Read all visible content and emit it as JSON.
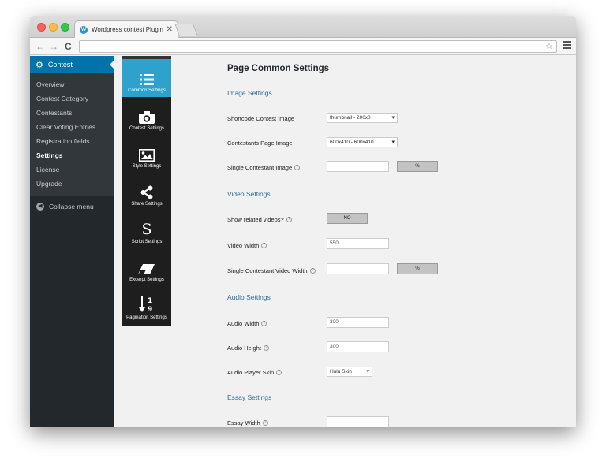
{
  "browser": {
    "tab_title": "Wordpress contest Plugin, W",
    "tab_favicon": "wordpress-icon",
    "close_glyph": "✕",
    "back_glyph": "←",
    "forward_glyph": "→",
    "reload_glyph": "C",
    "star_glyph": "☆"
  },
  "wp_menu": {
    "current_label": "Contest",
    "items": [
      {
        "label": "Overview"
      },
      {
        "label": "Contest Category"
      },
      {
        "label": "Contestants"
      },
      {
        "label": "Clear Voting Entries"
      },
      {
        "label": "Registration fields"
      },
      {
        "label": "Settings"
      },
      {
        "label": "License"
      },
      {
        "label": "Upgrade"
      }
    ],
    "collapse_label": "Collapse menu"
  },
  "plugin_nav": {
    "items": [
      {
        "label": "Common Settings",
        "icon": "list-icon"
      },
      {
        "label": "Contest Settings",
        "icon": "camera-icon"
      },
      {
        "label": "Style Settings",
        "icon": "image-icon"
      },
      {
        "label": "Share Settings",
        "icon": "share-icon"
      },
      {
        "label": "Script Settings",
        "icon": "strikethrough-icon"
      },
      {
        "label": "Excerpt Settings",
        "icon": "eraser-icon"
      },
      {
        "label": "Pagination Settings",
        "icon": "sort-numeric-icon"
      }
    ],
    "active_index": 0
  },
  "page": {
    "title": "Page Common Settings",
    "image_settings": {
      "heading": "Image Settings",
      "shortcode_label": "Shortcode Contest Image",
      "shortcode_value": "thumbnail - 200x0",
      "contestants_label": "Contestants Page Image",
      "contestants_value": "600x410 - 600x410",
      "single_label": "Single Contestant Image",
      "single_value": "",
      "single_unit": "%"
    },
    "video_settings": {
      "heading": "Video Settings",
      "related_label": "Show related videos?",
      "related_value": "NO",
      "width_label": "Video Width",
      "width_value": "550",
      "single_width_label": "Single Contestant Video Width",
      "single_width_value": "",
      "single_width_unit": "%"
    },
    "audio_settings": {
      "heading": "Audio Settings",
      "width_label": "Audio Width",
      "width_value": "300",
      "height_label": "Audio Height",
      "height_value": "300",
      "skin_label": "Audio Player Skin",
      "skin_value": "Hulu Skin"
    },
    "essay_settings": {
      "heading": "Essay Settings",
      "width_label": "Essay Width",
      "width_value": ""
    }
  },
  "colors": {
    "wp_sidebar": "#23282d",
    "wp_accent": "#0073aa",
    "plugin_nav_bg": "#1e1e1e",
    "plugin_nav_active": "#2ea2cc",
    "section_heading": "#2b6e9a"
  }
}
